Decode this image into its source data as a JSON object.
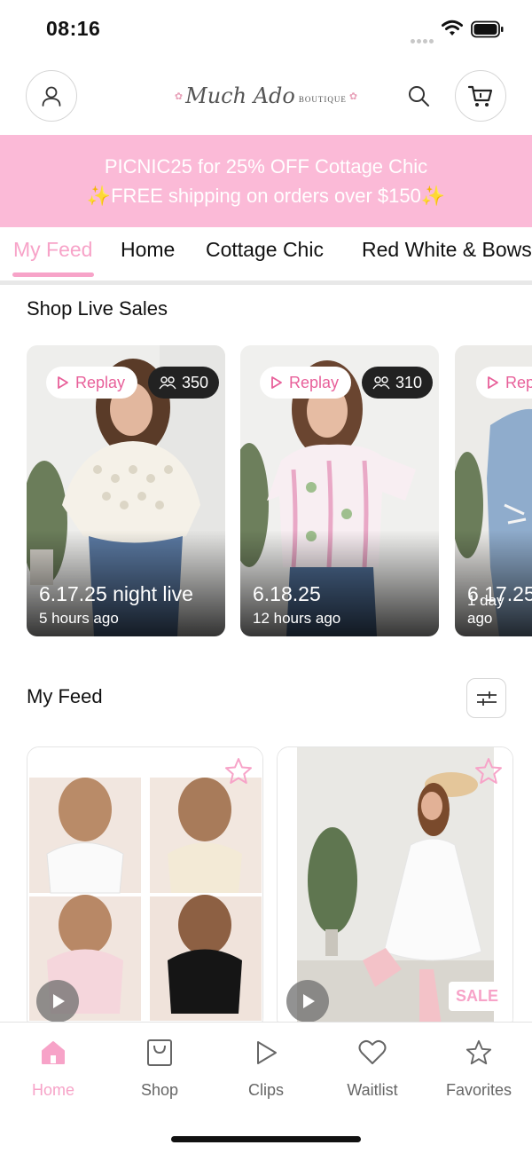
{
  "status_bar": {
    "time": "08:16",
    "icons": [
      "signal-dots-icon",
      "wifi-icon",
      "battery-icon"
    ]
  },
  "header": {
    "logo_script": "Much Ado",
    "logo_small": "BOUTIQUE",
    "icons": [
      "account-icon",
      "search-icon",
      "cart-icon"
    ]
  },
  "promo": {
    "line1": "PICNIC25 for 25% OFF Cottage Chic",
    "line2": "✨FREE shipping on orders over $150✨",
    "background": "#fbbad7"
  },
  "tabs": {
    "items": [
      {
        "label": "My Feed"
      },
      {
        "label": "Home"
      },
      {
        "label": "Cottage Chic"
      },
      {
        "label": "Red White & Bows"
      }
    ],
    "active": "My Feed",
    "accent": "#f7a3c8"
  },
  "live_sales": {
    "title": "Shop Live Sales",
    "cards": [
      {
        "badge": "Replay",
        "viewers": "350",
        "title": "6.17.25 night live",
        "time": "5 hours ago"
      },
      {
        "badge": "Replay",
        "viewers": "310",
        "title": "6.18.25",
        "time": "12 hours ago"
      },
      {
        "badge": "Replay",
        "viewers": "",
        "title": "6.17.25",
        "time": "1 day ago"
      }
    ]
  },
  "feed": {
    "title": "My Feed",
    "products": [
      {
        "description": "bralette four-pack",
        "badge": ""
      },
      {
        "description": "white eyelet dress with cowboy hat",
        "badge": "SALE"
      }
    ]
  },
  "bottom_nav": {
    "items": [
      {
        "label": "Home",
        "icon": "home-icon"
      },
      {
        "label": "Shop",
        "icon": "shopping-bag-icon"
      },
      {
        "label": "Clips",
        "icon": "play-icon"
      },
      {
        "label": "Waitlist",
        "icon": "heart-icon"
      },
      {
        "label": "Favorites",
        "icon": "star-icon"
      }
    ],
    "active": "Home"
  }
}
